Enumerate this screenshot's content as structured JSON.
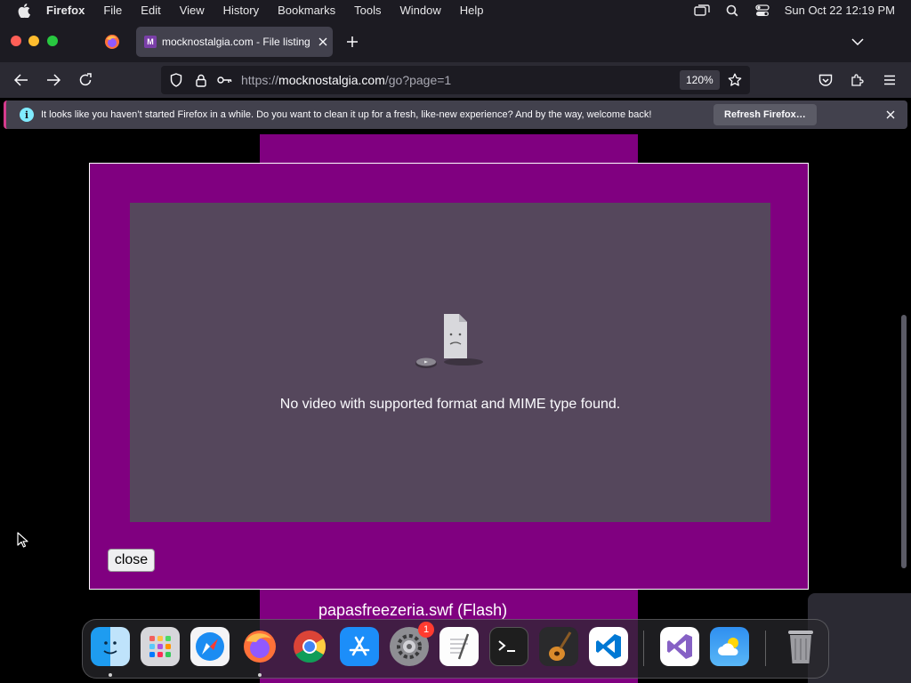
{
  "menubar": {
    "app_name": "Firefox",
    "menus": [
      "File",
      "Edit",
      "View",
      "History",
      "Bookmarks",
      "Tools",
      "Window",
      "Help"
    ],
    "clock": "Sun Oct 22  12:19 PM"
  },
  "tabs": {
    "active_title": "mocknostalgia.com - File listing"
  },
  "navbar": {
    "url_prefix": "https://",
    "url_host": "mocknostalgia.com",
    "url_path": "/go?page=1",
    "zoom": "120%"
  },
  "notification": {
    "message": "It looks like you haven’t started Firefox in a while. Do you want to clean it up for a fresh, like-new experience? And by the way, welcome back!",
    "button": "Refresh Firefox…"
  },
  "page": {
    "video_error": "No video with supported format and MIME type found.",
    "close_label": "close",
    "caption": "papasfreezeria.swf (Flash)",
    "accent_color": "#800080"
  },
  "dock": {
    "apps": [
      "finder-icon",
      "launchpad-icon",
      "safari-icon",
      "firefox-icon",
      "chrome-icon",
      "app-store-icon",
      "system-settings-icon",
      "textedit-icon",
      "terminal-icon",
      "garageband-icon",
      "vscode-icon",
      "visual-studio-icon",
      "weather-icon",
      "trash-icon"
    ],
    "settings_badge": "1"
  }
}
